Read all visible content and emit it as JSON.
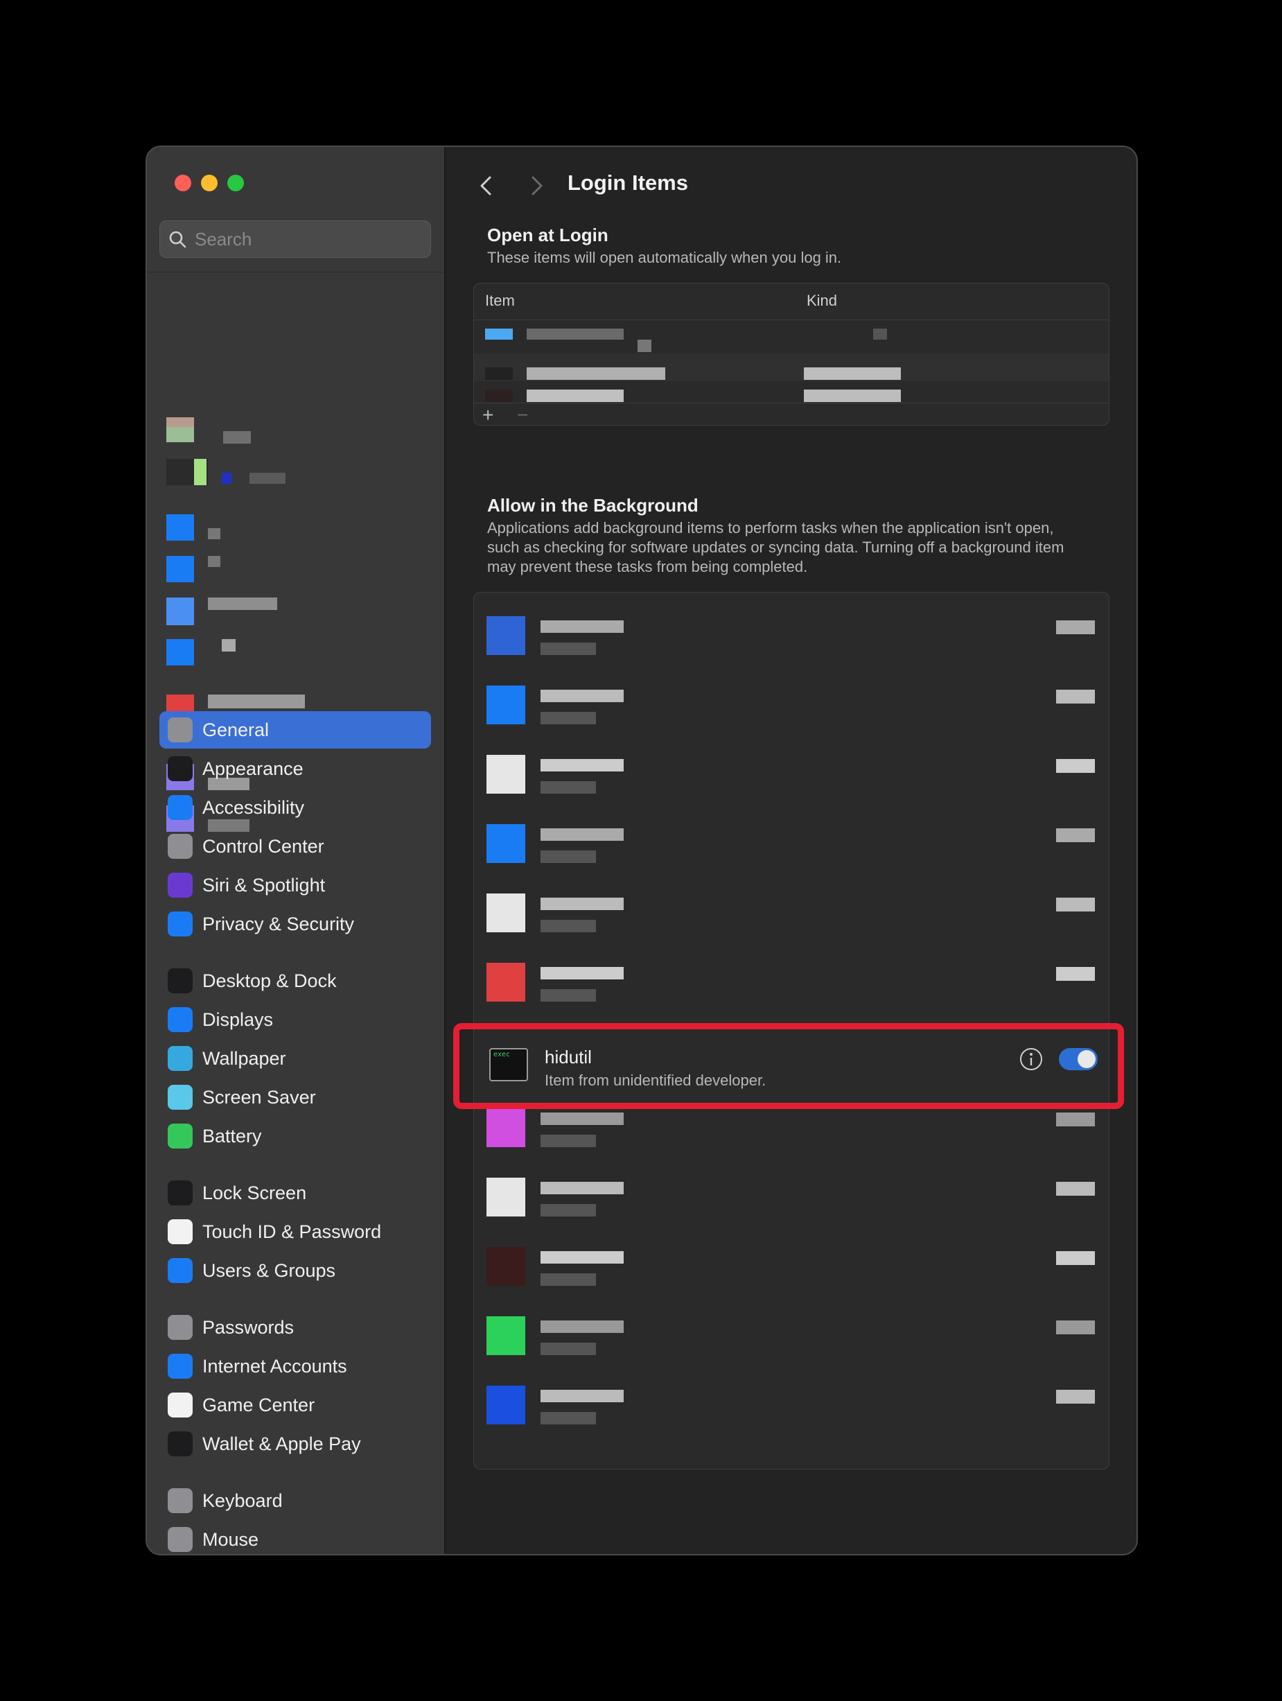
{
  "window": {
    "traffic_lights": {
      "close": "#ff5f57",
      "minimize": "#febc2e",
      "zoom": "#28c840"
    }
  },
  "sidebar": {
    "search_placeholder": "Search",
    "items": [
      {
        "label": "General",
        "icon": "gear-icon",
        "color": "#8e8e93",
        "active": true
      },
      {
        "label": "Appearance",
        "icon": "appearance-icon",
        "color": "#1c1c1e"
      },
      {
        "label": "Accessibility",
        "icon": "accessibility-icon",
        "color": "#1a7cf5"
      },
      {
        "label": "Control Center",
        "icon": "control-center-icon",
        "color": "#8e8e93"
      },
      {
        "label": "Siri & Spotlight",
        "icon": "siri-icon",
        "color": "#6a3ad0"
      },
      {
        "label": "Privacy & Security",
        "icon": "hand-icon",
        "color": "#1a7cf5"
      },
      {
        "label": "Desktop & Dock",
        "icon": "dock-icon",
        "color": "#1c1c1e"
      },
      {
        "label": "Displays",
        "icon": "sun-icon",
        "color": "#1a7cf5"
      },
      {
        "label": "Wallpaper",
        "icon": "flower-icon",
        "color": "#35a8e0"
      },
      {
        "label": "Screen Saver",
        "icon": "screen-saver-icon",
        "color": "#5ac8e8"
      },
      {
        "label": "Battery",
        "icon": "battery-icon",
        "color": "#34c759"
      },
      {
        "label": "Lock Screen",
        "icon": "lock-icon",
        "color": "#1c1c1e"
      },
      {
        "label": "Touch ID & Password",
        "icon": "fingerprint-icon",
        "color": "#f2f2f2"
      },
      {
        "label": "Users & Groups",
        "icon": "users-icon",
        "color": "#1a7cf5"
      },
      {
        "label": "Passwords",
        "icon": "key-icon",
        "color": "#8e8e93"
      },
      {
        "label": "Internet Accounts",
        "icon": "at-icon",
        "color": "#1a7cf5"
      },
      {
        "label": "Game Center",
        "icon": "game-center-icon",
        "color": "#f2f2f2"
      },
      {
        "label": "Wallet & Apple Pay",
        "icon": "wallet-icon",
        "color": "#1c1c1e"
      },
      {
        "label": "Keyboard",
        "icon": "keyboard-icon",
        "color": "#8e8e93"
      },
      {
        "label": "Mouse",
        "icon": "mouse-icon",
        "color": "#8e8e93"
      }
    ]
  },
  "header": {
    "title": "Login Items"
  },
  "open_at_login": {
    "title": "Open at Login",
    "subtitle": "These items will open automatically when you log in.",
    "columns": [
      "Item",
      "Kind"
    ],
    "add_label": "+",
    "remove_label": "−"
  },
  "background": {
    "title": "Allow in the Background",
    "subtitle": "Applications add background items to perform tasks when the application isn't open, such as checking for software updates or syncing data. Turning off a background item may prevent these tasks from being completed.",
    "highlighted_item": {
      "name": "hidutil",
      "description": "Item from unidentified developer.",
      "icon": "exec-icon",
      "icon_text": "exec",
      "enabled": true
    }
  },
  "help_label": "?"
}
